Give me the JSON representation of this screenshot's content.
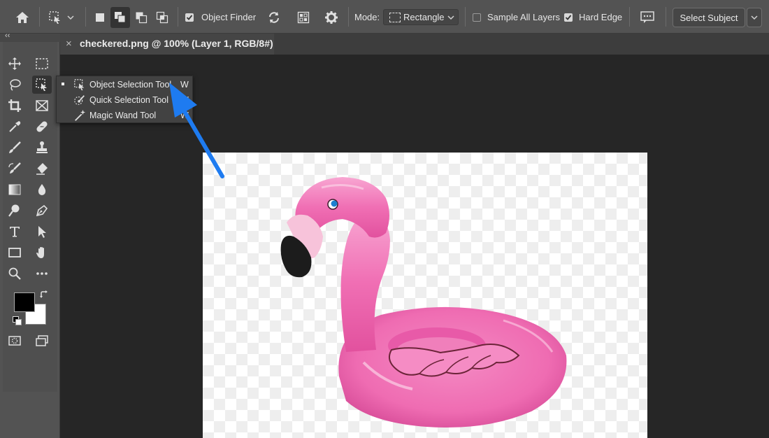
{
  "options_bar": {
    "object_finder_label": "Object Finder",
    "object_finder_checked": true,
    "mode_label": "Mode:",
    "mode_value": "Rectangle",
    "sample_all_layers_label": "Sample All Layers",
    "sample_all_layers_checked": false,
    "hard_edge_label": "Hard Edge",
    "hard_edge_checked": true,
    "select_subject_label": "Select Subject"
  },
  "document_tab": {
    "close_glyph": "×",
    "title": "checkered.png @ 100% (Layer 1, RGB/8#)"
  },
  "toolbar": {
    "collapse_glyph": "‹‹",
    "foreground_color": "#000000",
    "background_color": "#ffffff"
  },
  "flyout": {
    "items": [
      {
        "label": "Object Selection Tool",
        "shortcut": "W",
        "selected": true,
        "icon": "object-selection-icon"
      },
      {
        "label": "Quick Selection Tool",
        "shortcut": "W",
        "selected": false,
        "icon": "quick-selection-icon"
      },
      {
        "label": "Magic Wand Tool",
        "shortcut": "W",
        "selected": false,
        "icon": "magic-wand-icon"
      }
    ]
  },
  "colors": {
    "accent_arrow": "#1e7bf0",
    "flamingo_pink": "#f06fb4"
  }
}
